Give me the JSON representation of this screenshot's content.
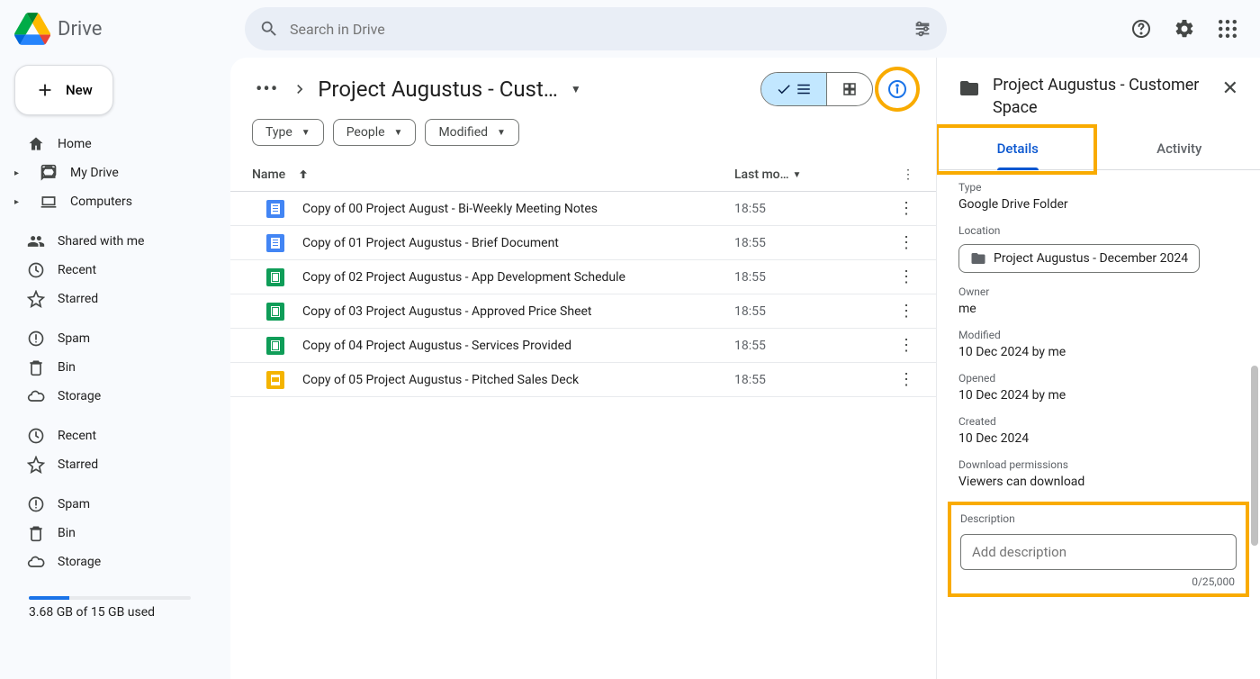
{
  "app": {
    "name": "Drive"
  },
  "search": {
    "placeholder": "Search in Drive"
  },
  "sidebar": {
    "new_label": "New",
    "items_primary": [
      {
        "label": "Home",
        "icon": "home"
      },
      {
        "label": "My Drive",
        "icon": "drive",
        "expandable": true
      },
      {
        "label": "Computers",
        "icon": "laptop",
        "expandable": true
      }
    ],
    "items_secondary": [
      {
        "label": "Shared with me",
        "icon": "people"
      },
      {
        "label": "Recent",
        "icon": "clock"
      },
      {
        "label": "Starred",
        "icon": "star"
      }
    ],
    "items_tertiary": [
      {
        "label": "Spam",
        "icon": "spam"
      },
      {
        "label": "Bin",
        "icon": "trash"
      },
      {
        "label": "Storage",
        "icon": "cloud"
      }
    ],
    "items_quaternary": [
      {
        "label": "Recent",
        "icon": "clock"
      },
      {
        "label": "Starred",
        "icon": "star"
      }
    ],
    "items_quinary": [
      {
        "label": "Spam",
        "icon": "spam"
      },
      {
        "label": "Bin",
        "icon": "trash"
      },
      {
        "label": "Storage",
        "icon": "cloud"
      }
    ],
    "storage_used": "3.68 GB of 15 GB used"
  },
  "main": {
    "breadcrumb_current": "Project Augustus - Cust…",
    "chips": {
      "type": "Type",
      "people": "People",
      "modified": "Modified"
    },
    "table": {
      "col_name": "Name",
      "col_modified": "Last mo…"
    },
    "files": [
      {
        "name": "Copy of 00 Project August - Bi-Weekly Meeting Notes",
        "modified": "18:55",
        "type": "doc"
      },
      {
        "name": "Copy of 01 Project Augustus - Brief Document",
        "modified": "18:55",
        "type": "doc"
      },
      {
        "name": "Copy of 02 Project Augustus - App Development Schedule",
        "modified": "18:55",
        "type": "sheet"
      },
      {
        "name": "Copy of 03 Project Augustus - Approved Price Sheet",
        "modified": "18:55",
        "type": "sheet"
      },
      {
        "name": "Copy of 04 Project Augustus - Services Provided",
        "modified": "18:55",
        "type": "sheet"
      },
      {
        "name": "Copy of 05 Project Augustus - Pitched Sales Deck",
        "modified": "18:55",
        "type": "slides"
      }
    ]
  },
  "sidepanel": {
    "title": "Project Augustus - Customer Space",
    "tabs": {
      "details": "Details",
      "activity": "Activity"
    },
    "type_label": "Type",
    "type_value": "Google Drive Folder",
    "location_label": "Location",
    "location_value": "Project Augustus - December 2024",
    "owner_label": "Owner",
    "owner_value": "me",
    "modified_label": "Modified",
    "modified_value": "10 Dec 2024 by me",
    "opened_label": "Opened",
    "opened_value": "10 Dec 2024 by me",
    "created_label": "Created",
    "created_value": "10 Dec 2024",
    "permissions_label": "Download permissions",
    "permissions_value": "Viewers can download",
    "description_label": "Description",
    "description_placeholder": "Add description",
    "description_counter": "0/25,000"
  }
}
